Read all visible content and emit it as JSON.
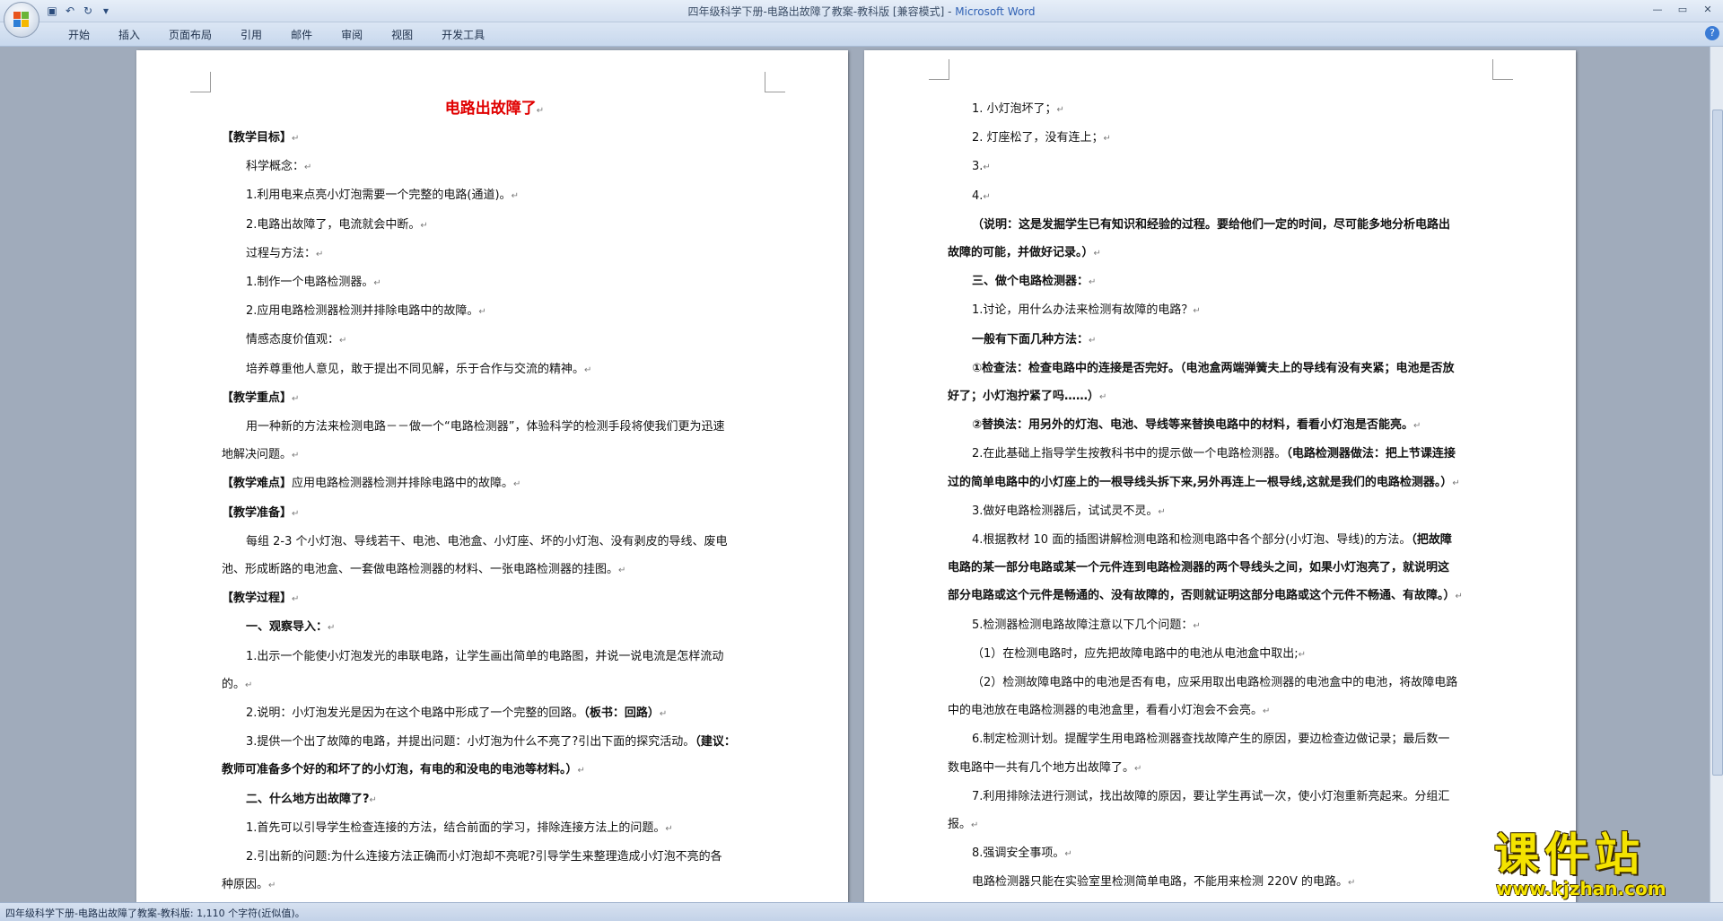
{
  "window": {
    "title_doc": "四年级科学下册-电路出故障了教案-教科版 [兼容模式]",
    "title_sep": " - ",
    "title_app": "Microsoft Word"
  },
  "ribbon": {
    "tabs": [
      "开始",
      "插入",
      "页面布局",
      "引用",
      "邮件",
      "审阅",
      "视图",
      "开发工具"
    ]
  },
  "colors": {
    "title_red": "#e00000",
    "watermark_yellow": "#f4e300"
  },
  "document": {
    "title": "电路出故障了",
    "left": [
      {
        "t": "【教学目标】",
        "b": true
      },
      {
        "t": "科学概念：",
        "ind": true
      },
      {
        "t": "1.利用电来点亮小灯泡需要一个完整的电路(通道)。",
        "ind": true
      },
      {
        "t": "2.电路出故障了，电流就会中断。",
        "ind": true
      },
      {
        "t": "过程与方法：",
        "ind": true
      },
      {
        "t": "1.制作一个电路检测器。",
        "ind": true
      },
      {
        "t": "2.应用电路检测器检测并排除电路中的故障。",
        "ind": true
      },
      {
        "t": "情感态度价值观：",
        "ind": true
      },
      {
        "t": "培养尊重他人意见，敢于提出不同见解，乐于合作与交流的精神。",
        "ind": true
      },
      {
        "t": "【教学重点】",
        "b": true
      },
      {
        "t": "用一种新的方法来检测电路－－做一个“电路检测器”，体验科学的检测手段将使我们更为迅速",
        "ind": true,
        "nopm": true
      },
      {
        "t": "地解决问题。"
      },
      {
        "t": "【教学难点】应用电路检测器检测并排除电路中的故障。",
        "bpre": "【教学难点】"
      },
      {
        "t": "【教学准备】",
        "b": true
      },
      {
        "t": "每组 2-3 个小灯泡、导线若干、电池、电池盒、小灯座、坏的小灯泡、没有剥皮的导线、废电",
        "ind": true,
        "nopm": true
      },
      {
        "t": "池、形成断路的电池盒、一套做电路检测器的材料、一张电路检测器的挂图。"
      },
      {
        "t": "【教学过程】",
        "b": true
      },
      {
        "t": "一、观察导入：",
        "ind": true,
        "b": true
      },
      {
        "t": "1.出示一个能使小灯泡发光的串联电路，让学生画出简单的电路图，并说一说电流是怎样流动",
        "ind": true,
        "nopm": true
      },
      {
        "t": "的。"
      },
      {
        "t": "2.说明：小灯泡发光是因为在这个电路中形成了一个完整的回路。（板书：回路）",
        "ind": true,
        "bsuf": "（板书：回路）"
      },
      {
        "t": "3.提供一个出了故障的电路，并提出问题：小灯泡为什么不亮了?引出下面的探究活动。（建议：",
        "ind": true,
        "nopm": true,
        "bsuf": "（建议："
      },
      {
        "t": "教师可准备多个好的和坏了的小灯泡，有电的和没电的电池等材料。）",
        "b": true
      },
      {
        "t": "二、什么地方出故障了?",
        "ind": true,
        "b": true
      },
      {
        "t": "1.首先可以引导学生检查连接的方法，结合前面的学习，排除连接方法上的问题。",
        "ind": true
      },
      {
        "t": "2.引出新的问题:为什么连接方法正确而小灯泡却不亮呢?引导学生来整理造成小灯泡不亮的各",
        "ind": true,
        "nopm": true
      },
      {
        "t": "种原因。"
      }
    ],
    "right": [
      {
        "t": "1. 小灯泡坏了；",
        "ind": true
      },
      {
        "t": "2. 灯座松了，没有连上；",
        "ind": true
      },
      {
        "t": "3.",
        "ind": true
      },
      {
        "t": "4.",
        "ind": true
      },
      {
        "t": "（说明：这是发掘学生已有知识和经验的过程。要给他们一定的时间，尽可能多地分析电路出",
        "ind": true,
        "b": true,
        "nopm": true
      },
      {
        "t": "故障的可能，并做好记录。）",
        "b": true
      },
      {
        "t": "三、做个电路检测器：",
        "ind": true,
        "b": true
      },
      {
        "t": "1.讨论，用什么办法来检测有故障的电路？",
        "ind": true
      },
      {
        "t": "一般有下面几种方法：",
        "ind": true,
        "b": true
      },
      {
        "t": "①检查法：检查电路中的连接是否完好。（电池盒两端弹簧夫上的导线有没有夹紧；电池是否放",
        "ind": true,
        "b": true,
        "nopm": true
      },
      {
        "t": "好了；小灯泡拧紧了吗……）",
        "b": true
      },
      {
        "t": "②替换法：用另外的灯泡、电池、导线等来替换电路中的材料，看看小灯泡是否能亮。",
        "ind": true,
        "b": true
      },
      {
        "t": "2.在此基础上指导学生按教科书中的提示做一个电路检测器。（电路检测器做法：把上节课连接",
        "ind": true,
        "nopm": true,
        "bsuf": "（电路检测器做法：把上节课连接"
      },
      {
        "t": "过的简单电路中的小灯座上的一根导线头拆下来,另外再连上一根导线,这就是我们的电路检测器。）",
        "b": true
      },
      {
        "t": "3.做好电路检测器后，试试灵不灵。",
        "ind": true
      },
      {
        "t": "4.根据教材 10 面的插图讲解检测电路和检测电路中各个部分(小灯泡、导线)的方法。（把故障",
        "ind": true,
        "nopm": true,
        "bsuf": "（把故障"
      },
      {
        "t": "电路的某一部分电路或某一个元件连到电路检测器的两个导线头之间，如果小灯泡亮了，就说明这",
        "b": true,
        "nopm": true
      },
      {
        "t": "部分电路或这个元件是畅通的、没有故障的，否则就证明这部分电路或这个元件不畅通、有故障。）",
        "b": true
      },
      {
        "t": "5.检测器检测电路故障注意以下几个问题：",
        "ind": true
      },
      {
        "t": "（1）在检测电路时，应先把故障电路中的电池从电池盒中取出;",
        "ind": true
      },
      {
        "t": "（2）检测故障电路中的电池是否有电，应采用取出电路检测器的电池盒中的电池，将故障电路",
        "ind": true,
        "nopm": true
      },
      {
        "t": "中的电池放在电路检测器的电池盒里，看看小灯泡会不会亮。"
      },
      {
        "t": "6.制定检测计划。提醒学生用电路检测器查找故障产生的原因，要边检查边做记录；最后数一",
        "ind": true,
        "nopm": true
      },
      {
        "t": "数电路中一共有几个地方出故障了。"
      },
      {
        "t": "7.利用排除法进行测试，找出故障的原因，要让学生再试一次，使小灯泡重新亮起来。分组汇",
        "ind": true,
        "nopm": true
      },
      {
        "t": "报。"
      },
      {
        "t": "8.强调安全事项。",
        "ind": true
      },
      {
        "t": "电路检测器只能在实验室里检测简单电路，不能用来检测 220V 的电路。",
        "ind": true
      }
    ]
  },
  "statusbar": {
    "text": "四年级科学下册-电路出故障了教案-教科版: 1,110 个字符(近似值)。"
  },
  "watermark": {
    "main": "课件站",
    "url": "www.kjzhan.com"
  }
}
